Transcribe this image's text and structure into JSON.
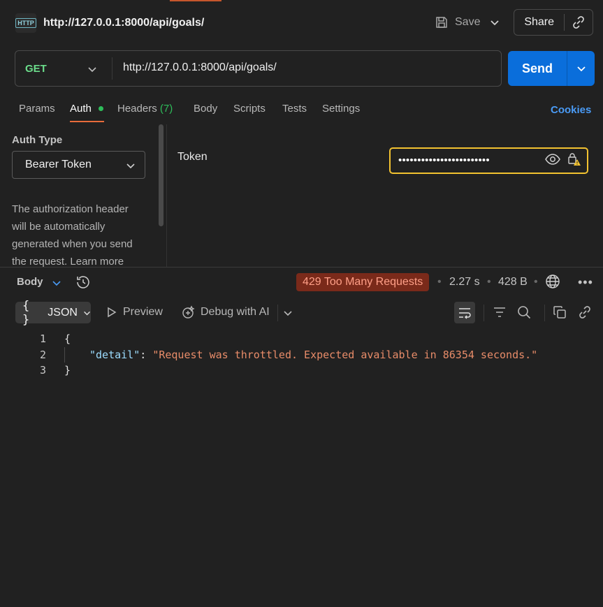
{
  "request": {
    "badge": "HTTP",
    "title": "http://127.0.0.1:8000/api/goals/",
    "save_label": "Save",
    "share_label": "Share",
    "method": "GET",
    "url": "http://127.0.0.1:8000/api/goals/",
    "send_label": "Send"
  },
  "tabs": [
    {
      "label": "Params"
    },
    {
      "label": "Auth"
    },
    {
      "label": "Headers",
      "count": "(7)"
    },
    {
      "label": "Body"
    },
    {
      "label": "Scripts"
    },
    {
      "label": "Tests"
    },
    {
      "label": "Settings"
    }
  ],
  "cookies_label": "Cookies",
  "auth": {
    "type_label": "Auth Type",
    "type_value": "Bearer Token",
    "description_lines": [
      "The authorization header",
      "will be automatically",
      "generated when you send",
      "the request. Learn more"
    ],
    "token_label": "Token",
    "token_masked": "••••••••••••••••••••••••"
  },
  "response": {
    "body_label": "Body",
    "status": "429 Too Many Requests",
    "time": "2.27 s",
    "size": "428 B",
    "format": "JSON",
    "preview_label": "Preview",
    "debug_label": "Debug with AI",
    "lines": [
      {
        "n": "1",
        "text": "{"
      },
      {
        "n": "2",
        "key": "\"detail\"",
        "sep": ": ",
        "value": "\"Request was throttled. Expected available in 86354 seconds.\""
      },
      {
        "n": "3",
        "text": "}"
      }
    ]
  },
  "colors": {
    "accent_send": "#0a6edb",
    "method_get": "#6bdd8b",
    "status_bg": "#7a2a1a",
    "status_fg": "#ff9f87",
    "token_border": "#f2c230",
    "cookies": "#4a9bf5"
  },
  "icons": [
    "http-icon",
    "save-icon",
    "chevron-down-icon",
    "link-icon",
    "eye-icon",
    "lock-warning-icon",
    "history-icon",
    "globe-icon",
    "more-icon",
    "braces-icon",
    "play-icon",
    "debug-ai-icon",
    "wrap-lines-icon",
    "filter-icon",
    "search-icon",
    "copy-icon"
  ]
}
